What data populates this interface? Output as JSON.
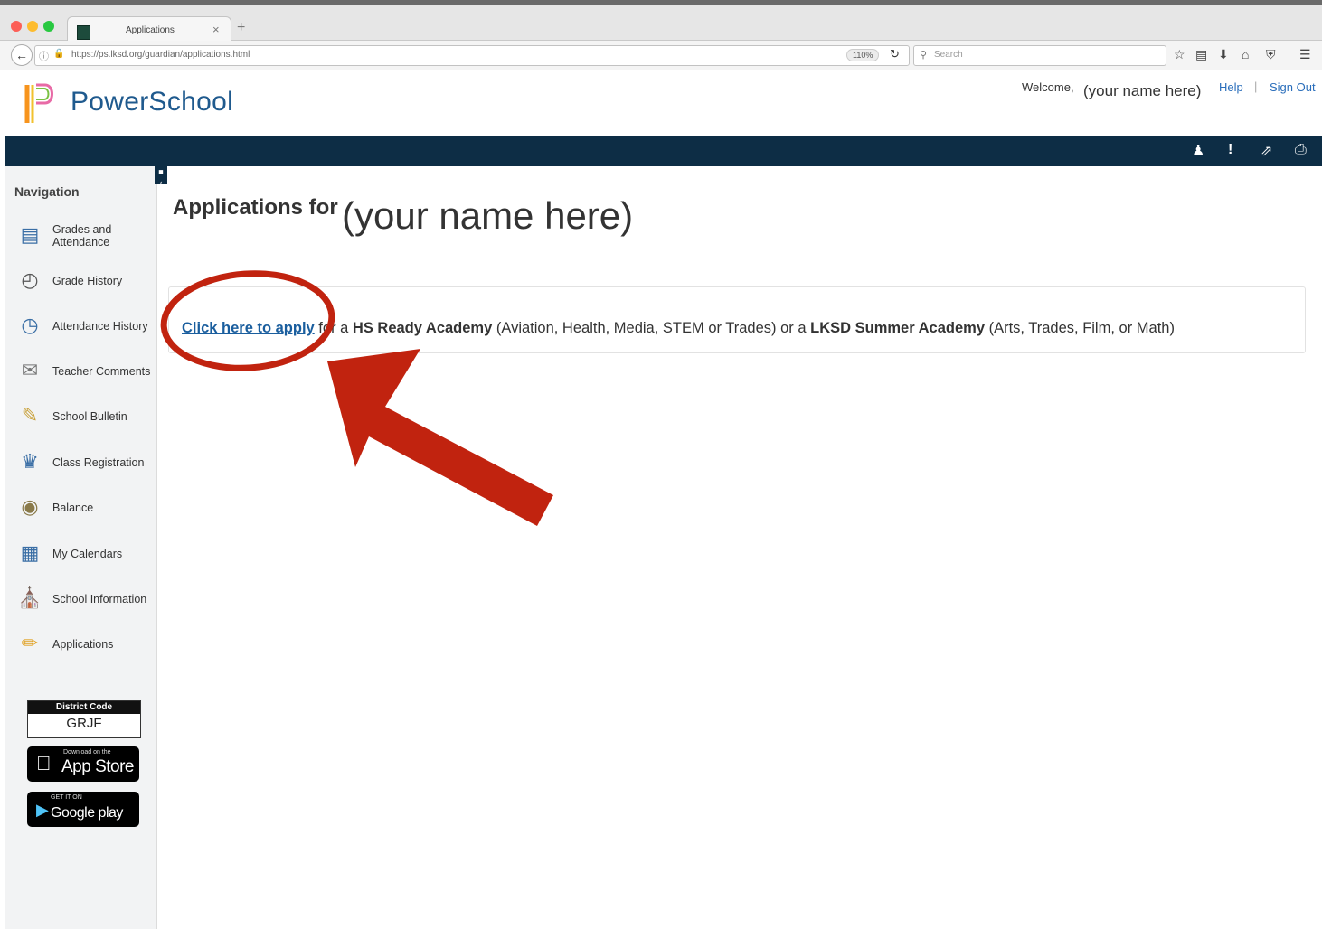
{
  "browser": {
    "tab_title": "Applications",
    "tab_close": "×",
    "new_tab": "+",
    "url": "https://ps.lksd.org/guardian/applications.html",
    "zoom": "110%",
    "search_placeholder": "Search",
    "back_icon": "arrow-left-icon",
    "reload_icon": "reload-icon",
    "toolbar_icons": [
      "star-icon",
      "clipboard-icon",
      "download-icon",
      "home-icon",
      "pocket-icon",
      "menu-icon"
    ]
  },
  "header": {
    "brand": "PowerSchool",
    "welcome_label": "Welcome,",
    "welcome_name": "(your name here)",
    "help": "Help",
    "separator": "|",
    "sign_out": "Sign Out"
  },
  "toolbar": {
    "icons": [
      "person-icon",
      "alert-icon",
      "external-link-icon",
      "print-icon"
    ]
  },
  "sidebar": {
    "heading": "Navigation",
    "items": [
      {
        "label": "Grades and Attendance",
        "icon": "grades-icon"
      },
      {
        "label": "Grade History",
        "icon": "grade-history-icon"
      },
      {
        "label": "Attendance History",
        "icon": "attendance-icon"
      },
      {
        "label": "Teacher Comments",
        "icon": "comments-icon"
      },
      {
        "label": "School Bulletin",
        "icon": "bulletin-icon"
      },
      {
        "label": "Class Registration",
        "icon": "registration-icon"
      },
      {
        "label": "Balance",
        "icon": "balance-icon"
      },
      {
        "label": "My Calendars",
        "icon": "calendar-icon"
      },
      {
        "label": "School Information",
        "icon": "school-icon"
      },
      {
        "label": "Applications",
        "icon": "pencil-icon"
      }
    ],
    "district_code_label": "District Code",
    "district_code": "GRJF",
    "app_store_small": "Download on the",
    "app_store_big": "App Store",
    "google_play_small": "GET IT ON",
    "google_play_big": "Google play"
  },
  "main": {
    "title_label": "Applications for",
    "title_name": "(your name here)",
    "apply": {
      "link": "Click here to apply",
      "t1": " for a ",
      "b1": "HS Ready Academy",
      "t2": " (Aviation, Health, Media, STEM or Trades) or a ",
      "b2": "LKSD Summer Academy",
      "t3": " (Arts, Trades, Film, or Math)"
    }
  },
  "colors": {
    "brand_blue": "#1f5a8e",
    "navbar_dark": "#0d2d45",
    "link_blue": "#1a5e9e",
    "annotation_red": "#c1230f"
  }
}
